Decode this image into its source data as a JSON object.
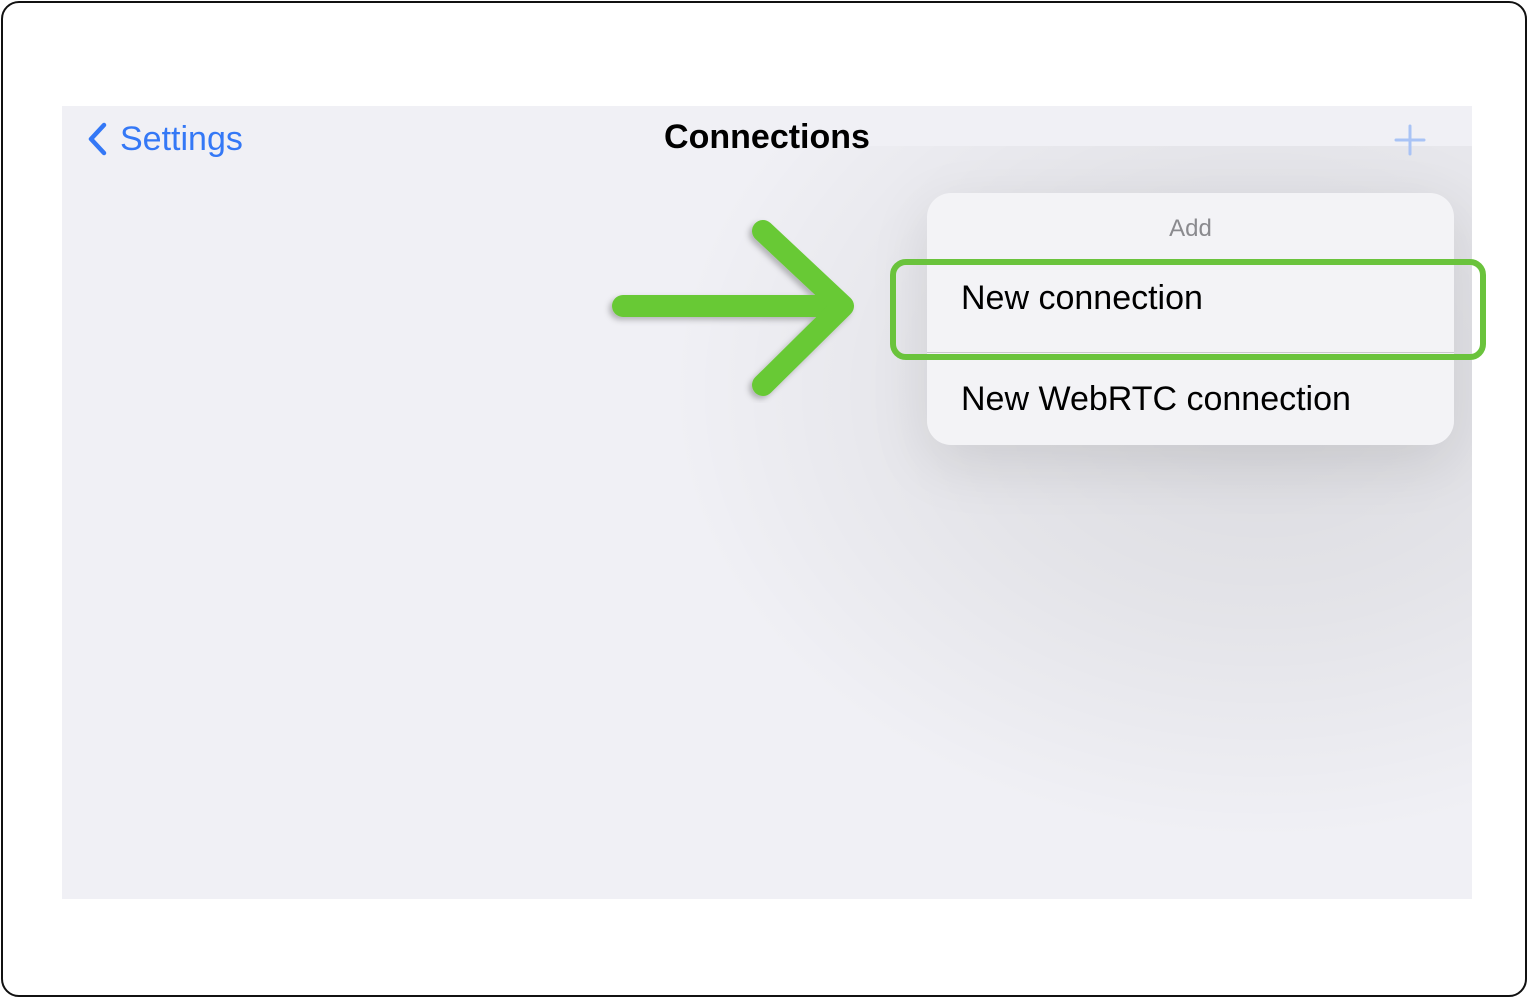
{
  "nav": {
    "back_label": "Settings",
    "title": "Connections",
    "add_icon": "plus-icon"
  },
  "menu": {
    "header": "Add",
    "items": [
      {
        "label": "New connection",
        "highlighted": true
      },
      {
        "label": "New WebRTC connection",
        "highlighted": false
      }
    ]
  },
  "annotation": {
    "arrow_icon": "arrow-right-icon",
    "highlight_color": "#6ac33c"
  },
  "colors": {
    "accent": "#3478f6",
    "background": "#f0f0f5",
    "menu_background": "#f3f3f6",
    "header_text": "#8a8a8e"
  }
}
